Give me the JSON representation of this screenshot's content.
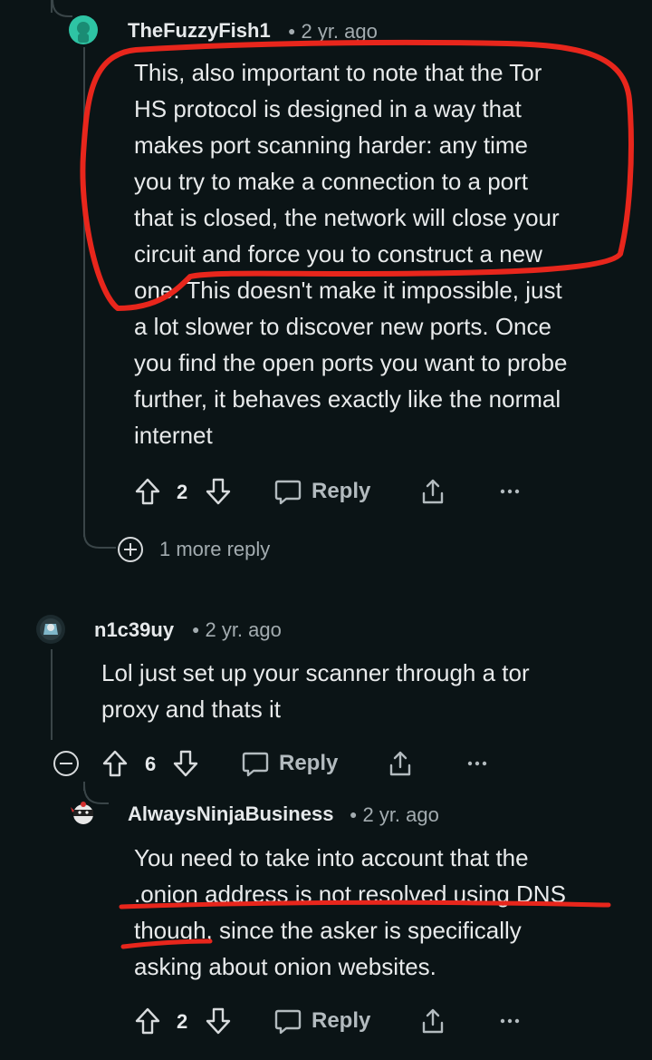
{
  "comments": [
    {
      "author": "TheFuzzyFish1",
      "time": "2 yr. ago",
      "body": "This, also important to note that the Tor\nHS protocol is designed in a way that\nmakes port scanning harder: any time\nyou try to make a connection to a port\nthat is closed, the network will close your\ncircuit and force you to construct a new\none. This doesn't make it impossible, just\na lot slower to discover new ports. Once\nyou find the open ports you want to probe\nfurther, it behaves exactly like the normal\ninternet",
      "votes": "2",
      "reply_label": "Reply",
      "more_replies": "1 more reply"
    },
    {
      "author": "n1c39uy",
      "time": "2 yr. ago",
      "body": "Lol just set up your scanner through a tor\nproxy and thats it",
      "votes": "6",
      "reply_label": "Reply"
    },
    {
      "author": "AlwaysNinjaBusiness",
      "time": "2 yr. ago",
      "body": "You need to take into account that the\n.onion address is not resolved using DNS\nthough, since the asker is specifically\nasking about onion websites.",
      "votes": "2",
      "reply_label": "Reply"
    }
  ],
  "colors": {
    "background": "#0b1416",
    "annotation": "#e8261c",
    "avatar_teal": "#2ec4a4"
  },
  "icons": [
    "upvote-icon",
    "downvote-icon",
    "comment-icon",
    "share-icon",
    "more-options-icon",
    "expand-icon",
    "collapse-icon"
  ]
}
